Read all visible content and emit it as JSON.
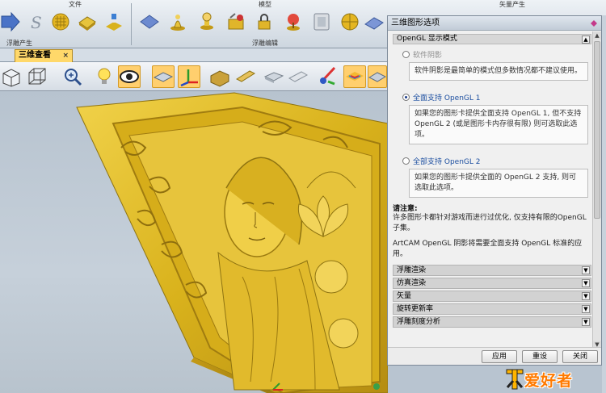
{
  "ribbon": {
    "group_titles": [
      "文件",
      "模型",
      "矢量产生"
    ],
    "group_labels": [
      "浮雕产生",
      "浮雕编辑"
    ]
  },
  "tabs": {
    "active": {
      "label": "三维查看",
      "close": "×"
    }
  },
  "dialog": {
    "title": "三维图形选项",
    "section_opengl": "OpenGL 显示模式",
    "options": [
      {
        "label": "软件阴影",
        "state": "disabled",
        "description": "软件阴影是最简单的模式但多数情况都不建议使用。"
      },
      {
        "label": "全面支持 OpenGL 1",
        "state": "selected",
        "description": "如果您的图形卡提供全面支持 OpenGL 1, 但不支持 OpenGL 2 (或是图形卡内存很有限) 则可选取此选项。"
      },
      {
        "label": "全部支持 OpenGL 2",
        "state": "normal",
        "description": "如果您的图形卡提供全面的 OpenGL 2 支持, 则可选取此选项。"
      }
    ],
    "note_title": "请注意:",
    "note_lines": [
      "许多图形卡都针对游戏而进行过优化, 仅支持有限的OpenGL子集。",
      "ArtCAM OpenGL 阴影将需要全面支持 OpenGL 标准的应用。"
    ],
    "collapsed_sections": [
      "浮雕渲染",
      "仿真渲染",
      "矢量",
      "旋转更新率",
      "浮雕刻度分析"
    ],
    "buttons": {
      "apply": "应用",
      "reset": "重设",
      "close": "关闭"
    }
  },
  "watermark": {
    "text": "爱好者"
  },
  "colors": {
    "accent_tab": "#ffd86a",
    "relief_gold": "#d9b21c",
    "watermark_orange": "#ff7a00"
  }
}
